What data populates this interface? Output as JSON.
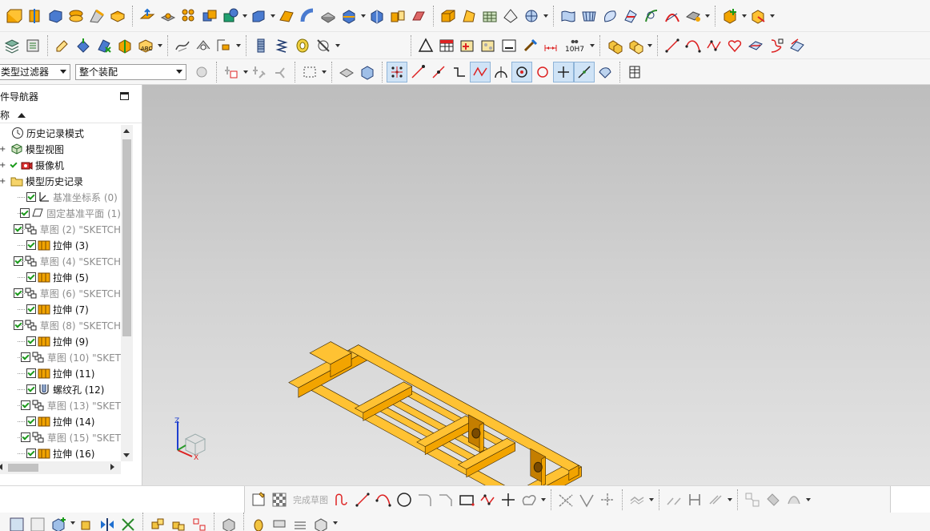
{
  "filter": {
    "type_filter": "类型过滤器",
    "scope": "整个装配"
  },
  "navigator": {
    "title": "部件导航器",
    "column_name": "名称",
    "items": [
      {
        "label": "历史记录模式",
        "icon": "clock-icon",
        "check": false,
        "grey": false,
        "indent": 0
      },
      {
        "label": "模型视图",
        "icon": "model-view-icon",
        "check": false,
        "grey": false,
        "indent": 0
      },
      {
        "label": "摄像机",
        "icon": "camera-icon",
        "check": true,
        "grey": false,
        "indent": 0
      },
      {
        "label": "模型历史记录",
        "icon": "folder-icon",
        "check": false,
        "grey": false,
        "indent": 0
      },
      {
        "label": "基准坐标系 (0)",
        "icon": "datum-csys-icon",
        "check": true,
        "grey": true,
        "indent": 1
      },
      {
        "label": "固定基准平面 (1)",
        "icon": "datum-plane-icon",
        "check": true,
        "grey": true,
        "indent": 1
      },
      {
        "label": "草图 (2) \"SKETCH",
        "icon": "sketch-icon",
        "check": true,
        "grey": true,
        "indent": 1
      },
      {
        "label": "拉伸 (3)",
        "icon": "extrude-icon",
        "check": true,
        "grey": false,
        "indent": 1
      },
      {
        "label": "草图 (4) \"SKETCH",
        "icon": "sketch-icon",
        "check": true,
        "grey": true,
        "indent": 1
      },
      {
        "label": "拉伸 (5)",
        "icon": "extrude-icon",
        "check": true,
        "grey": false,
        "indent": 1
      },
      {
        "label": "草图 (6) \"SKETCH",
        "icon": "sketch-icon",
        "check": true,
        "grey": true,
        "indent": 1
      },
      {
        "label": "拉伸 (7)",
        "icon": "extrude-icon",
        "check": true,
        "grey": false,
        "indent": 1
      },
      {
        "label": "草图 (8) \"SKETCH",
        "icon": "sketch-icon",
        "check": true,
        "grey": true,
        "indent": 1
      },
      {
        "label": "拉伸 (9)",
        "icon": "extrude-icon",
        "check": true,
        "grey": false,
        "indent": 1
      },
      {
        "label": "草图 (10) \"SKET",
        "icon": "sketch-icon",
        "check": true,
        "grey": true,
        "indent": 1
      },
      {
        "label": "拉伸 (11)",
        "icon": "extrude-icon",
        "check": true,
        "grey": false,
        "indent": 1
      },
      {
        "label": "螺纹孔 (12)",
        "icon": "threaded-hole-icon",
        "check": true,
        "grey": false,
        "indent": 1
      },
      {
        "label": "草图 (13) \"SKET",
        "icon": "sketch-icon",
        "check": true,
        "grey": true,
        "indent": 1
      },
      {
        "label": "拉伸 (14)",
        "icon": "extrude-icon",
        "check": true,
        "grey": false,
        "indent": 1
      },
      {
        "label": "草图 (15) \"SKET",
        "icon": "sketch-icon",
        "check": true,
        "grey": true,
        "indent": 1
      },
      {
        "label": "拉伸 (16)",
        "icon": "extrude-icon",
        "check": true,
        "grey": false,
        "indent": 1
      }
    ]
  },
  "view": {
    "triad": {
      "z": "Z",
      "x": "X"
    }
  },
  "sketch_toolbar": {
    "finish_sketch": "完成草图"
  },
  "toolbar2": {
    "fit_label": "10H7"
  },
  "colors": {
    "part": "#f2a400",
    "part_dark": "#c47e00",
    "part_light": "#ffc233"
  }
}
